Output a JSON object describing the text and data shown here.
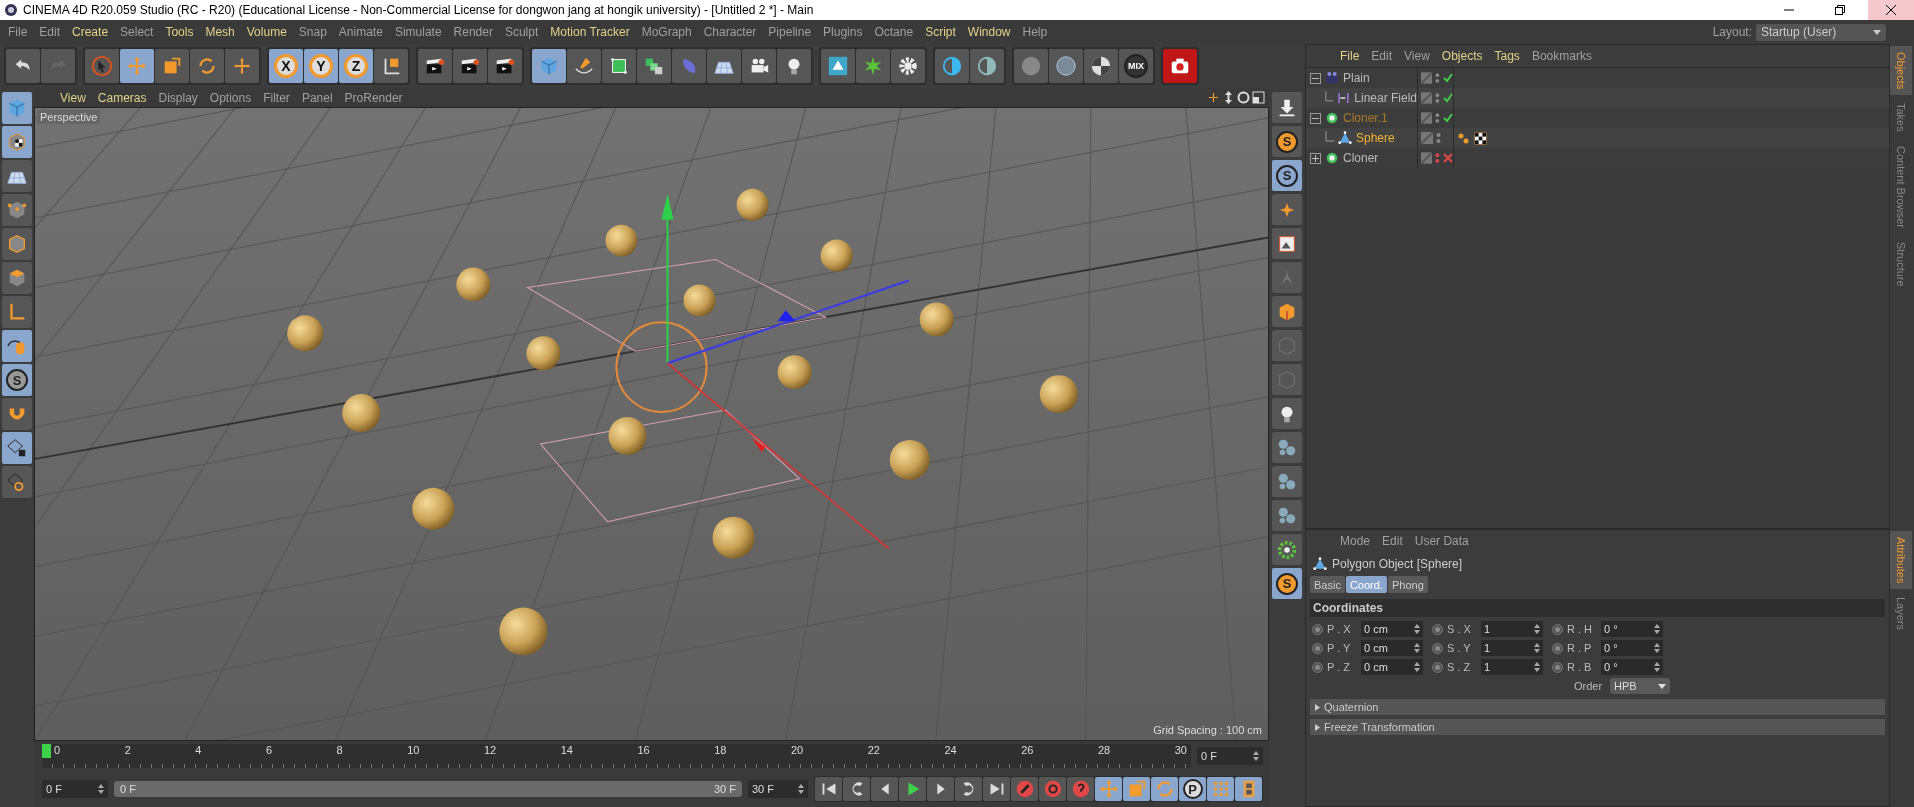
{
  "window": {
    "title": "CINEMA 4D R20.059 Studio (RC - R20) (Educational License - Non-Commercial License for dongwon jang at hongik university) - [Untitled 2 *] - Main"
  },
  "menu": [
    {
      "label": "File",
      "highlight": false
    },
    {
      "label": "Edit",
      "highlight": false
    },
    {
      "label": "Create",
      "highlight": true
    },
    {
      "label": "Select",
      "highlight": false
    },
    {
      "label": "Tools",
      "highlight": true
    },
    {
      "label": "Mesh",
      "highlight": true
    },
    {
      "label": "Volume",
      "highlight": true
    },
    {
      "label": "Snap",
      "highlight": false
    },
    {
      "label": "Animate",
      "highlight": false
    },
    {
      "label": "Simulate",
      "highlight": false
    },
    {
      "label": "Render",
      "highlight": false
    },
    {
      "label": "Sculpt",
      "highlight": false
    },
    {
      "label": "Motion Tracker",
      "highlight": true
    },
    {
      "label": "MoGraph",
      "highlight": false
    },
    {
      "label": "Character",
      "highlight": false
    },
    {
      "label": "Pipeline",
      "highlight": false
    },
    {
      "label": "Plugins",
      "highlight": false
    },
    {
      "label": "Octane",
      "highlight": false
    },
    {
      "label": "Script",
      "highlight": true
    },
    {
      "label": "Window",
      "highlight": true
    },
    {
      "label": "Help",
      "highlight": false
    }
  ],
  "layout": {
    "label": "Layout:",
    "value": "Startup (User)"
  },
  "toolbar": [
    {
      "tools": [
        {
          "kind": "undo",
          "selected": false
        },
        {
          "kind": "redo",
          "selected": false
        }
      ]
    },
    {
      "tools": [
        {
          "kind": "pointer",
          "selected": false
        },
        {
          "kind": "move",
          "selected": true
        },
        {
          "kind": "scale",
          "selected": false
        },
        {
          "kind": "rotate",
          "selected": false
        },
        {
          "kind": "cross",
          "selected": false
        }
      ]
    },
    {
      "tools": [
        {
          "kind": "axis",
          "label": "X",
          "selected": true
        },
        {
          "kind": "axis",
          "label": "Y",
          "selected": true
        },
        {
          "kind": "axis",
          "label": "Z",
          "selected": true
        },
        {
          "kind": "coord",
          "selected": false
        }
      ]
    },
    {
      "tools": [
        {
          "kind": "clapper",
          "selected": false
        },
        {
          "kind": "clapper",
          "selected": false
        },
        {
          "kind": "clapper",
          "selected": false
        }
      ]
    },
    {
      "tools": [
        {
          "kind": "cube",
          "selected": true
        },
        {
          "kind": "pen",
          "selected": false
        },
        {
          "kind": "greencube",
          "selected": false
        },
        {
          "kind": "cubes",
          "selected": false
        },
        {
          "kind": "leaf",
          "selected": false
        },
        {
          "kind": "floor",
          "selected": false
        },
        {
          "kind": "camera",
          "selected": false
        },
        {
          "kind": "bulb",
          "selected": false
        }
      ]
    },
    {
      "tools": [
        {
          "kind": "plugin",
          "selected": false
        },
        {
          "kind": "star",
          "selected": false
        },
        {
          "kind": "gear",
          "selected": false
        }
      ]
    },
    {
      "tools": [
        {
          "kind": "contrast",
          "selected": false
        },
        {
          "kind": "contrast2",
          "selected": false
        }
      ]
    },
    {
      "tools": [
        {
          "kind": "ball",
          "selected": false
        },
        {
          "kind": "glass",
          "selected": false
        },
        {
          "kind": "checkball",
          "selected": false
        },
        {
          "kind": "mix",
          "label": "MIX",
          "selected": false
        }
      ]
    },
    {
      "tools": [
        {
          "kind": "record",
          "selected": false
        }
      ]
    }
  ],
  "left_tools": [
    {
      "kind": "cube",
      "selected": true
    },
    {
      "kind": "checkcube",
      "selected": true
    },
    {
      "kind": "floor",
      "selected": false
    },
    {
      "kind": "cubepoints",
      "selected": false
    },
    {
      "kind": "cubeedges",
      "selected": false
    },
    {
      "kind": "cubeface",
      "selected": false
    },
    {
      "kind": "axisl",
      "selected": false
    },
    {
      "kind": "mouse",
      "selected": true
    },
    {
      "kind": "scircle",
      "label": "S",
      "selected": true
    },
    {
      "kind": "magnet",
      "selected": false
    },
    {
      "kind": "gridlock",
      "selected": true
    },
    {
      "kind": "gridloop",
      "selected": false
    }
  ],
  "right_tools": [
    {
      "kind": "download",
      "selected": false
    },
    {
      "kind": "sorange",
      "label": "S",
      "selected": false
    },
    {
      "kind": "sblue",
      "label": "S",
      "selected": true
    },
    {
      "kind": "burst",
      "selected": false
    },
    {
      "kind": "picture",
      "selected": false
    },
    {
      "kind": "figure",
      "selected": false
    },
    {
      "kind": "orangecube",
      "selected": false
    },
    {
      "kind": "greycube",
      "selected": false
    },
    {
      "kind": "greycube",
      "selected": false
    },
    {
      "kind": "bulb",
      "selected": false
    },
    {
      "kind": "balls",
      "selected": false
    },
    {
      "kind": "balls",
      "selected": false
    },
    {
      "kind": "balls",
      "selected": false
    },
    {
      "kind": "greengear",
      "selected": false
    },
    {
      "kind": "sorange",
      "label": "S",
      "selected": true
    }
  ],
  "view_menu": [
    {
      "label": "View",
      "highlight": true
    },
    {
      "label": "Cameras",
      "highlight": true
    },
    {
      "label": "Display",
      "highlight": false
    },
    {
      "label": "Options",
      "highlight": false
    },
    {
      "label": "Filter",
      "highlight": false
    },
    {
      "label": "Panel",
      "highlight": false
    },
    {
      "label": "ProRender",
      "highlight": false
    }
  ],
  "viewport": {
    "camera": "Perspective",
    "grid_spacing": "Grid Spacing : 100 cm"
  },
  "timeline": {
    "ticks": [
      "0",
      "2",
      "4",
      "6",
      "8",
      "10",
      "12",
      "14",
      "16",
      "18",
      "20",
      "22",
      "24",
      "26",
      "28",
      "30"
    ],
    "level": 0,
    "current": "0 F",
    "start": "0 F",
    "range": {
      "start": "0 F",
      "end": "30 F",
      "level": 1
    },
    "end": "30 F",
    "buttons": [
      {
        "kind": "first",
        "selected": false
      },
      {
        "kind": "prevkey",
        "selected": false
      },
      {
        "kind": "prev",
        "selected": false
      },
      {
        "kind": "play",
        "selected": false
      },
      {
        "kind": "next",
        "selected": false
      },
      {
        "kind": "nextkey",
        "selected": false
      },
      {
        "kind": "last",
        "selected": false
      },
      {
        "kind": "reckey",
        "selected": false
      },
      {
        "kind": "autokey",
        "selected": false
      },
      {
        "kind": "question",
        "selected": false
      },
      {
        "kind": "move",
        "selected": true
      },
      {
        "kind": "scale",
        "selected": true
      },
      {
        "kind": "rotate",
        "selected": true
      },
      {
        "kind": "pcircle",
        "label": "P",
        "selected": true
      },
      {
        "kind": "dots",
        "selected": true
      },
      {
        "kind": "film",
        "selected": true
      }
    ]
  },
  "objects": {
    "menu": [
      {
        "label": "File",
        "highlight": true
      },
      {
        "label": "Edit",
        "highlight": false
      },
      {
        "label": "View",
        "highlight": false
      },
      {
        "label": "Objects",
        "highlight": true
      },
      {
        "label": "Tags",
        "highlight": true
      },
      {
        "label": "Bookmarks",
        "highlight": false
      }
    ],
    "tree": [
      {
        "name": "Plain",
        "kind": "plain",
        "expanded": true,
        "enabled": true,
        "selected": false,
        "parent_of_selected": false,
        "children": [
          {
            "name": "Linear Field",
            "kind": "field",
            "enabled": true,
            "selected": false,
            "parent_of_selected": false
          }
        ]
      },
      {
        "name": "Cloner.1",
        "kind": "cloner",
        "expanded": true,
        "enabled": true,
        "selected": false,
        "parent_of_selected": true,
        "children": [
          {
            "name": "Sphere",
            "kind": "polygon",
            "selected": true,
            "parent_of_selected": false,
            "tags": [
              {
                "kind": "phong"
              },
              {
                "kind": "texture"
              }
            ]
          }
        ]
      },
      {
        "name": "Cloner",
        "kind": "cloner",
        "expanded": false,
        "enabled": false,
        "selected": false,
        "parent_of_selected": false
      }
    ]
  },
  "attributes": {
    "menu": [
      "Mode",
      "Edit",
      "User Data"
    ],
    "title": "Polygon Object [Sphere]",
    "tabs": [
      {
        "label": "Basic",
        "selected": false
      },
      {
        "label": "Coord.",
        "selected": true
      },
      {
        "label": "Phong",
        "selected": false
      }
    ],
    "section": "Coordinates",
    "rows": [
      [
        {
          "label": "P . X",
          "value": "0 cm"
        },
        {
          "label": "S . X",
          "value": "1"
        },
        {
          "label": "R . H",
          "value": "0 °"
        }
      ],
      [
        {
          "label": "P . Y",
          "value": "0 cm"
        },
        {
          "label": "S . Y",
          "value": "1"
        },
        {
          "label": "R . P",
          "value": "0 °"
        }
      ],
      [
        {
          "label": "P . Z",
          "value": "0 cm"
        },
        {
          "label": "S . Z",
          "value": "1"
        },
        {
          "label": "R . B",
          "value": "0 °"
        }
      ]
    ],
    "order": {
      "label": "Order",
      "value": "HPB"
    },
    "groups": [
      {
        "label": "Quaternion",
        "expanded": false
      },
      {
        "label": "Freeze Transformation",
        "expanded": false
      }
    ]
  },
  "side_tabs_top": [
    {
      "label": "Objects",
      "selected": true
    },
    {
      "label": "Takes",
      "selected": false
    },
    {
      "label": "Content Browser",
      "selected": false
    },
    {
      "label": "Structure",
      "selected": false
    }
  ],
  "side_tabs_bottom": [
    {
      "label": "Attributes",
      "selected": true
    },
    {
      "label": "Layers",
      "selected": false
    }
  ]
}
